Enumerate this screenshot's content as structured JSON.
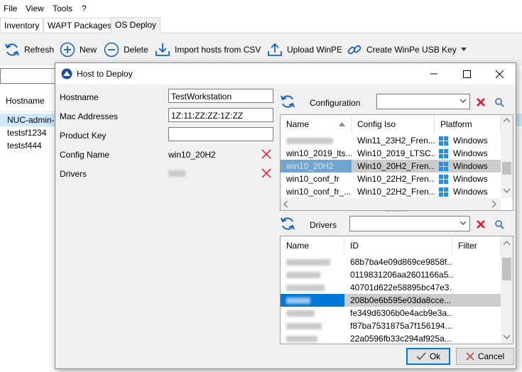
{
  "menubar": {
    "items": [
      "File",
      "View",
      "Tools",
      "?"
    ]
  },
  "tabs": [
    "Inventory",
    "WAPT Packages",
    "OS Deploy"
  ],
  "toolbar": {
    "refresh": "Refresh",
    "new": "New",
    "delete": "Delete",
    "import": "Import hosts from CSV",
    "upload": "Upload WinPE",
    "create_usb": "Create WinPe USB Key"
  },
  "hosts": {
    "header": "Hostname",
    "rows": [
      "NUC-admin-",
      "testsf1234",
      "testsf444"
    ]
  },
  "dialog": {
    "title": "Host to Deploy",
    "labels": {
      "hostname": "Hostname",
      "mac": "Mac Addresses",
      "product_key": "Product Key",
      "config_name": "Config Name",
      "drivers": "Drivers"
    },
    "values": {
      "hostname": "TestWorkstation",
      "mac": "1Z:11:ZZ:ZZ:1Z:ZZ",
      "product_key": "",
      "config_name": "win10_20H2"
    },
    "ok": "Ok",
    "cancel": "Cancel"
  },
  "configuration": {
    "label": "Configuration",
    "columns": [
      "Name",
      "Config Iso",
      "Platform"
    ],
    "rows": [
      {
        "name": "",
        "iso": "Win11_23H2_Fren...",
        "platform": "Windows"
      },
      {
        "name": "win10_2019_lts...",
        "iso": "Win10_2019_LTSC...",
        "platform": "Windows"
      },
      {
        "name": "win10_20H2",
        "iso": "Win10_20H2_Fren...",
        "platform": "Windows"
      },
      {
        "name": "win10_conf_fr",
        "iso": "Win10_22H2_Fren...",
        "platform": "Windows"
      },
      {
        "name": "win10_conf_fr_...",
        "iso": "Win10_22H2_Fren...",
        "platform": "Windows"
      }
    ],
    "selected_index": 2
  },
  "drivers": {
    "label": "Drivers",
    "columns": [
      "Name",
      "ID",
      "Filter"
    ],
    "rows": [
      {
        "name": "",
        "id": "68b7ba4e09d869ce9858f..."
      },
      {
        "name": "",
        "id": "0119831206aa2601166a5..."
      },
      {
        "name": "",
        "id": "40701d622e58895bc47e3..."
      },
      {
        "name": "",
        "id": "208b0e6b595e03da8cce..."
      },
      {
        "name": "",
        "id": "fe349d6306b0e4acb9e3a..."
      },
      {
        "name": "",
        "id": "f87ba7531875a7f156194..."
      },
      {
        "name": "",
        "id": "22a0596fb33c294af925a..."
      }
    ],
    "selected_index": 3
  },
  "colors": {
    "selection": "#0078d7",
    "selection_gray": "#cccccc",
    "icon_blue": "#1565c0",
    "delete_red": "#e81123"
  }
}
